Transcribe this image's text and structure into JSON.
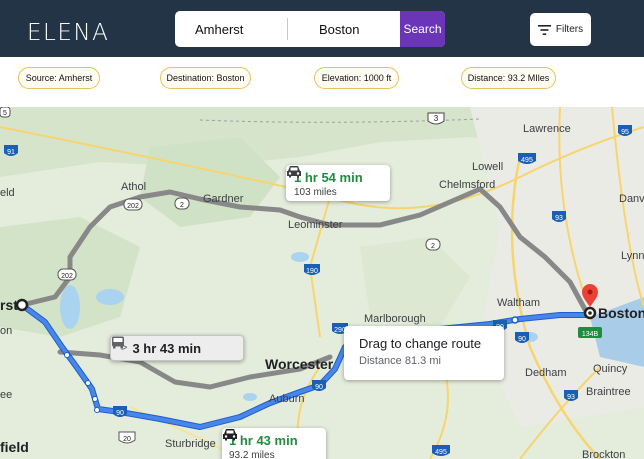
{
  "app": {
    "title": "ELENA"
  },
  "search": {
    "source_value": "Amherst",
    "destination_value": "Boston",
    "button_label": "Search"
  },
  "filters": {
    "label": "Filters"
  },
  "info": {
    "source": "Source: Amherst",
    "destination": "Destination: Boston",
    "elevation": "Elevation: 1000 ft",
    "distance": "Distance: 93.2 MIles"
  },
  "map": {
    "places": {
      "amherst": "rst",
      "boston": "Boston",
      "worcester": "Worcester",
      "athol": "Athol",
      "gardner": "Gardner",
      "leominster": "Leominster",
      "lowell": "Lowell",
      "lawrence": "Lawrence",
      "chelmsford": "Chelmsford",
      "waltham": "Waltham",
      "marlborough": "Marlborough",
      "auburn": "Auburn",
      "sturbridge": "Sturbridge",
      "dedham": "Dedham",
      "quincy": "Quincy",
      "braintree": "Braintree",
      "brockton": "Brockton",
      "lynn": "Lynn",
      "danvers": "Danv",
      "field_left": "field",
      "eld_left": "eld",
      "on_left": "on",
      "ee_left": "ee"
    },
    "shields": {
      "s3": "3",
      "s91": "91",
      "s2a": "2",
      "s2b": "2",
      "s202a": "202",
      "s202b": "202",
      "s495a": "495",
      "s495b": "495",
      "s93a": "93",
      "s93b": "93",
      "s95": "95",
      "s190": "190",
      "s290": "290",
      "s90a": "90",
      "s90b": "90",
      "s90c": "90",
      "s90d": "90",
      "s20": "20",
      "s134b": "134B",
      "s5": "5"
    },
    "route_north": {
      "time": "1 hr 54 min",
      "distance": "103 miles"
    },
    "route_transit": {
      "time": "3 hr 43 min"
    },
    "route_south": {
      "time": "1 hr 43 min",
      "distance": "93.2 miles"
    },
    "drag_tooltip": {
      "title": "Drag to change route",
      "distance": "Distance 81.3 mi"
    }
  },
  "colors": {
    "header": "#243447",
    "search_button": "#6a35b6",
    "pill_border": "#e6c25a",
    "route_selected": "#4a86e8",
    "route_alt": "#9aa0a6",
    "time_green": "#1e8e3e"
  }
}
